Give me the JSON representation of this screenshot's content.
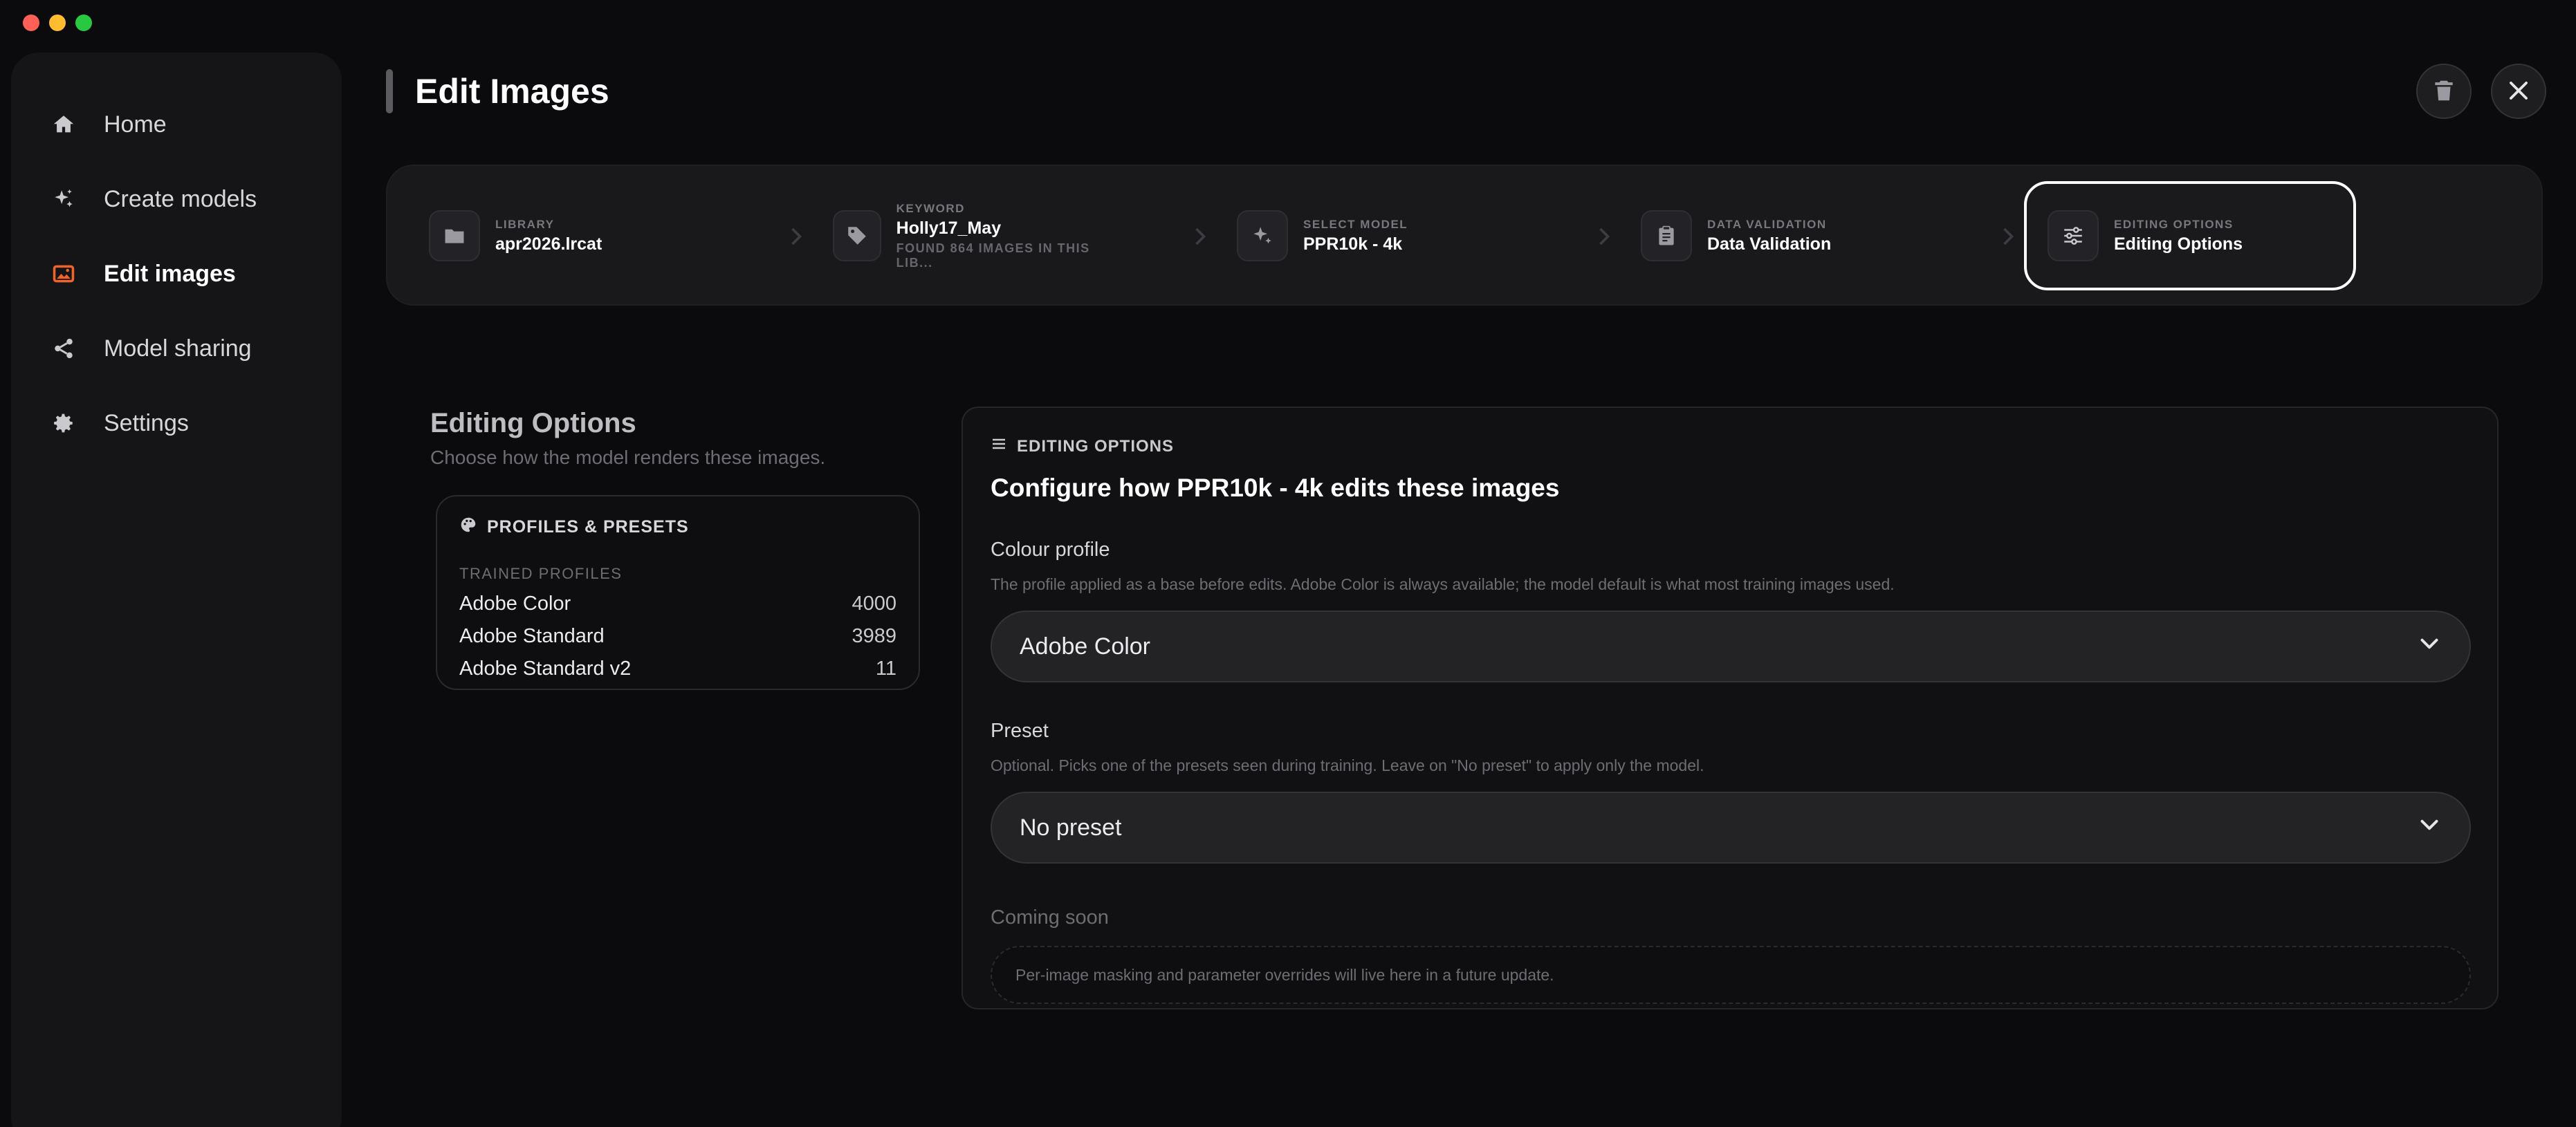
{
  "colors": {
    "accent": "#f0642c",
    "active_step_border": "#ffffff",
    "background": "#0b0b0d"
  },
  "sidebar": {
    "items": [
      {
        "label": "Home",
        "icon": "home-icon",
        "active": false
      },
      {
        "label": "Create models",
        "icon": "sparkles-icon",
        "active": false
      },
      {
        "label": "Edit images",
        "icon": "image-icon",
        "active": true
      },
      {
        "label": "Model sharing",
        "icon": "share-icon",
        "active": false
      },
      {
        "label": "Settings",
        "icon": "gear-icon",
        "active": false
      }
    ]
  },
  "header": {
    "title": "Edit Images",
    "delete_icon": "trash-icon",
    "close_icon": "close-icon"
  },
  "stepper": {
    "steps": [
      {
        "label": "LIBRARY",
        "value": "apr2026.lrcat",
        "sub": "",
        "icon": "folder-icon"
      },
      {
        "label": "KEYWORD",
        "value": "Holly17_May",
        "sub": "FOUND 864 IMAGES IN THIS LIB...",
        "icon": "tag-icon"
      },
      {
        "label": "SELECT MODEL",
        "value": "PPR10k - 4k",
        "sub": "",
        "icon": "sparkles-icon"
      },
      {
        "label": "DATA VALIDATION",
        "value": "Data Validation",
        "sub": "",
        "icon": "clipboard-icon"
      },
      {
        "label": "EDITING OPTIONS",
        "value": "Editing Options",
        "sub": "",
        "icon": "sliders-icon"
      }
    ]
  },
  "left": {
    "heading": "Editing Options",
    "subheading": "Choose how the model renders these images.",
    "profiles_card": {
      "title": "PROFILES & PRESETS",
      "trained_label": "TRAINED PROFILES",
      "profiles": [
        {
          "name": "Adobe Color",
          "count": "4000"
        },
        {
          "name": "Adobe Standard",
          "count": "3989"
        },
        {
          "name": "Adobe Standard v2",
          "count": "11"
        }
      ]
    }
  },
  "options": {
    "tag": "EDITING OPTIONS",
    "title": "Configure how PPR10k - 4k edits these images",
    "colour_profile": {
      "label": "Colour profile",
      "help": "The profile applied as a base before edits. Adobe Color is always available; the model default is what most training images used.",
      "selected": "Adobe Color"
    },
    "preset": {
      "label": "Preset",
      "help": "Optional. Picks one of the presets seen during training. Leave on \"No preset\" to apply only the model.",
      "selected": "No preset"
    },
    "coming_soon": {
      "label": "Coming soon",
      "text": "Per-image masking and parameter overrides will live here in a future update."
    }
  }
}
